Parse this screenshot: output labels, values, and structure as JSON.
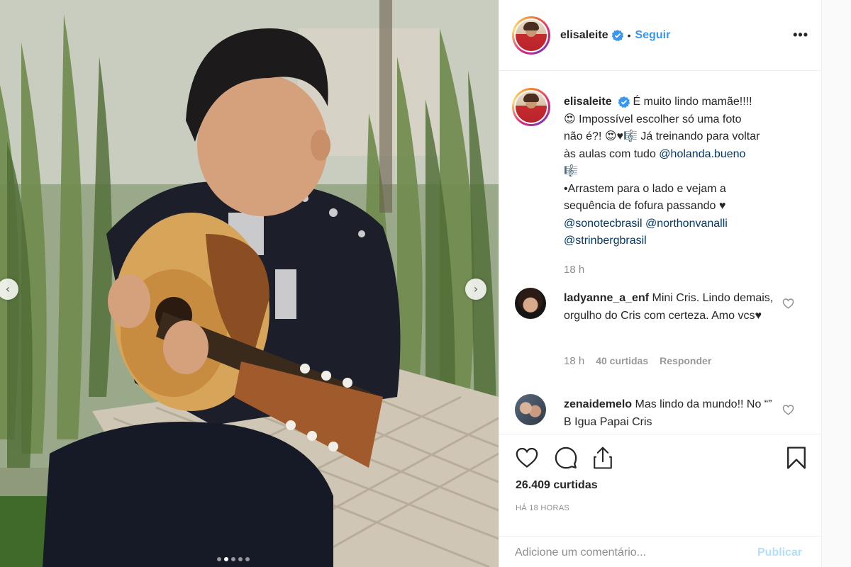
{
  "post": {
    "username": "elisaleite",
    "follow_label": "Seguir",
    "separator": "•",
    "more_label": "•••",
    "caption": {
      "username": "elisaleite",
      "line1": "É muito lindo mamãe!!!!",
      "line2": "😍 Impossível escolher só uma foto",
      "line3": "não é?! 😍♥🎼 Já treinando para voltar",
      "line4_prefix": "às aulas com tudo ",
      "mention1": "@holanda.bueno",
      "line5": "🎼",
      "line6": "•Arrastem para o lado e vejam a",
      "line7": "sequência de fofura passando ♥",
      "mention2": "@sonotecbrasil",
      "mention3": "@northonvanalli",
      "mention4": "@strinbergbrasil",
      "time": "18 h"
    },
    "comments": [
      {
        "username": "ladyanne_a_enf",
        "text": "Mini Cris. Lindo demais, orgulho do Cris com certeza. Amo vcs♥",
        "time": "18 h",
        "likes": "40 curtidas",
        "reply": "Responder"
      },
      {
        "username": "zenaidemelo",
        "text": "Mas lindo da mundo!! No “” B Igua Papai Cris"
      }
    ],
    "likes": "26.409 curtidas",
    "posted": "HÁ 18 HORAS",
    "comment_placeholder": "Adicione um comentário...",
    "publish_label": "Publicar"
  },
  "carousel": {
    "prev_icon": "‹",
    "next_icon": "›",
    "dots": 5,
    "active_dot": 1
  },
  "colors": {
    "link": "#3897f0",
    "mention": "#00376b",
    "muted": "#8e8e8e",
    "publish_disabled": "#b2dffc"
  }
}
